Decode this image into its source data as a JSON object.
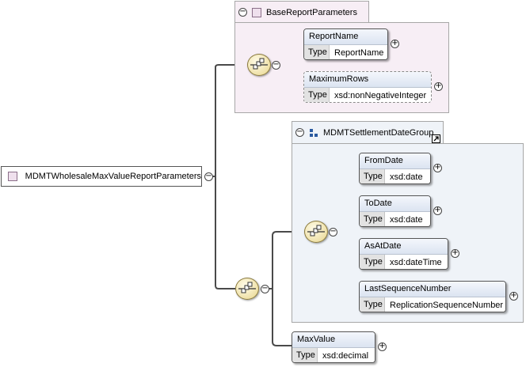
{
  "root": {
    "label": "MDMTWholesaleMaxValueReportParameters"
  },
  "groups": {
    "base": {
      "label": "BaseReportParameters"
    },
    "settlement": {
      "label": "MDMTSettlementDateGroup"
    }
  },
  "type_key": "Type",
  "elements": [
    {
      "name": "ReportName",
      "type": "ReportName"
    },
    {
      "name": "MaximumRows",
      "type": "xsd:nonNegativeInteger"
    },
    {
      "name": "FromDate",
      "type": "xsd:date"
    },
    {
      "name": "ToDate",
      "type": "xsd:date"
    },
    {
      "name": "AsAtDate",
      "type": "xsd:dateTime"
    },
    {
      "name": "LastSequenceNumber",
      "type": "ReplicationSequenceNumber"
    },
    {
      "name": "MaxValue",
      "type": "xsd:decimal"
    }
  ],
  "icons": {
    "expand": "plus-circle-icon",
    "collapse": "minus-circle-icon",
    "sequence": "sequence-compositor-icon",
    "group": "group-icon",
    "shortcut": "shortcut-arrow-icon"
  }
}
